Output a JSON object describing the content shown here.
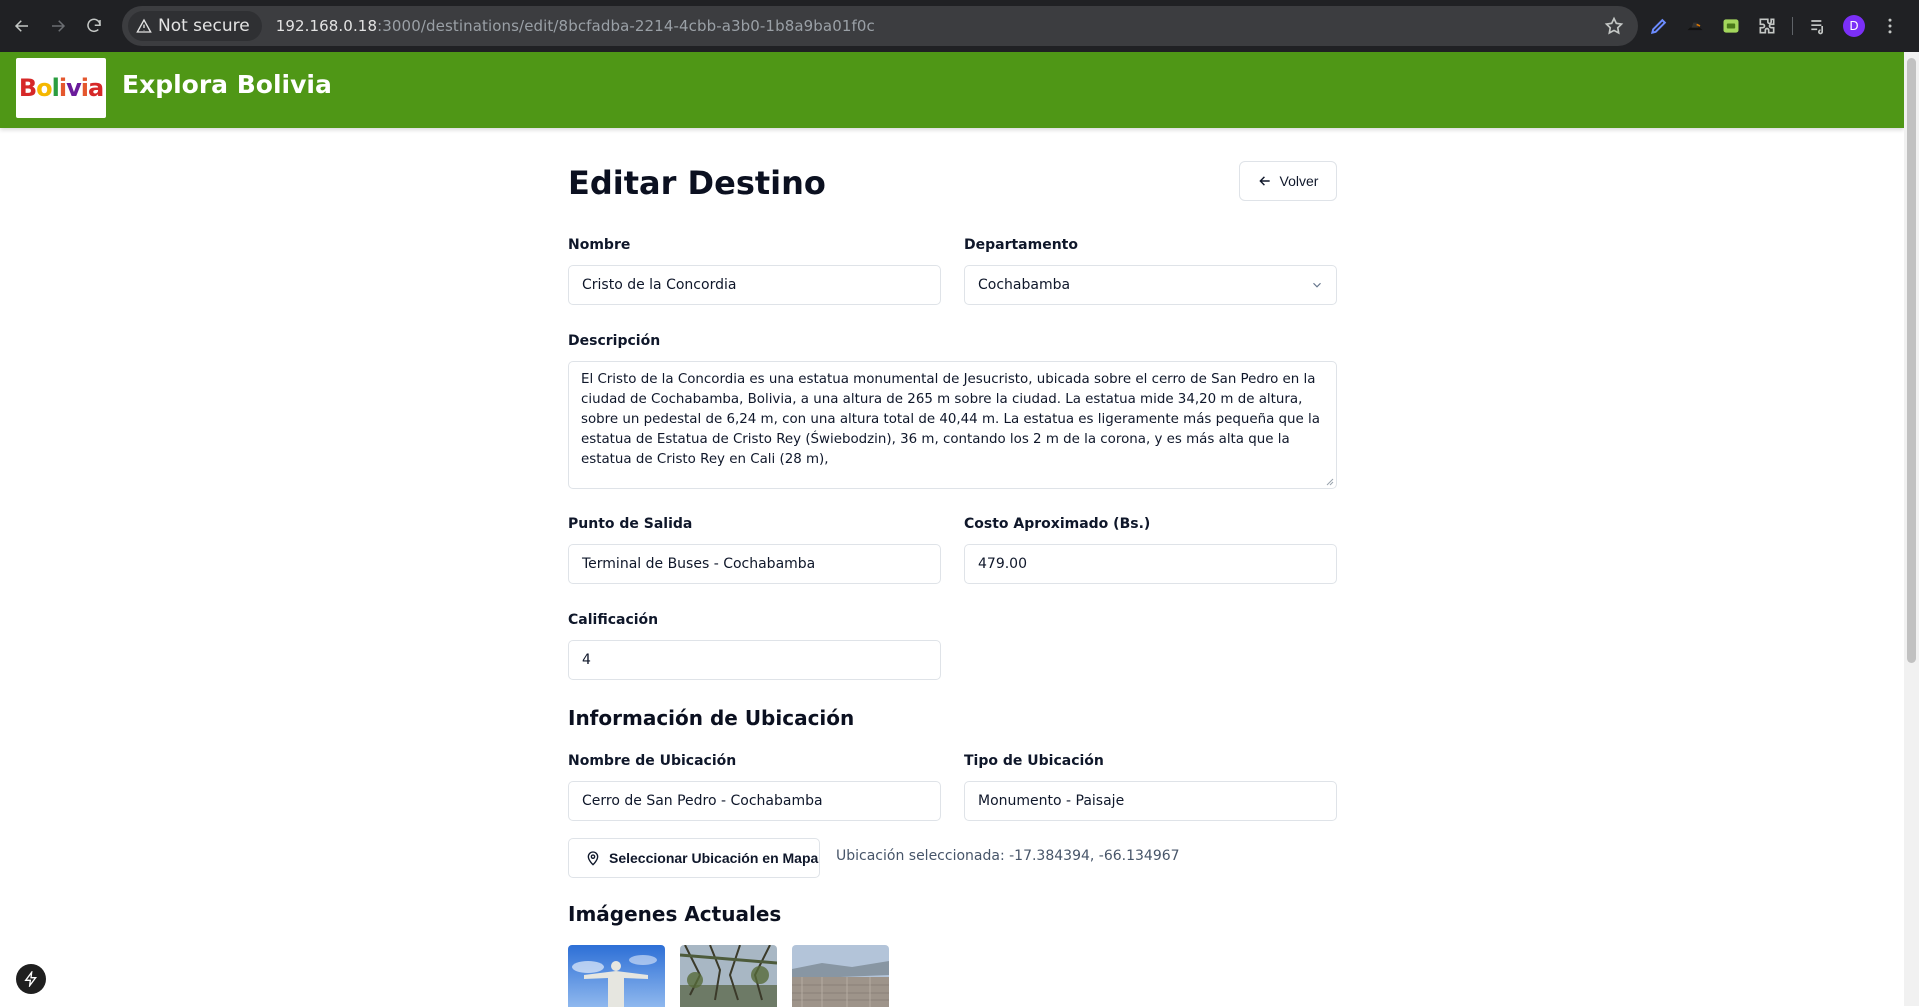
{
  "browser": {
    "security_label": "Not secure",
    "url_host": "192.168.0.18",
    "url_rest": ":3000/destinations/edit/8bcfadba-2214-4cbb-a3b0-1b8a9ba01f0c",
    "profile_initial": "D"
  },
  "header": {
    "logo_text": "Bolivia",
    "brand": "Explora Bolivia"
  },
  "page": {
    "title": "Editar Destino",
    "back_label": "Volver"
  },
  "form": {
    "nombre": {
      "label": "Nombre",
      "value": "Cristo de la Concordia"
    },
    "departamento": {
      "label": "Departamento",
      "value": "Cochabamba"
    },
    "descripcion": {
      "label": "Descripción",
      "value": "El Cristo de la Concordia es una estatua monumental de Jesucristo, ubicada sobre el cerro de San Pedro en la ciudad de Cochabamba, Bolivia, a una altura de 265 m sobre la ciudad. La estatua mide 34,20 m de altura, sobre un pedestal de 6,24 m, con una altura total de 40,44 m. La estatua es ligeramente más pequeña que la estatua de Estatua de Cristo Rey (Świebodzin), 36 m, contando los 2 m de la corona, y es más alta que la estatua de Cristo Rey en Cali (28 m),"
    },
    "punto_salida": {
      "label": "Punto de Salida",
      "value": "Terminal de Buses - Cochabamba"
    },
    "costo": {
      "label": "Costo Aproximado (Bs.)",
      "value": "479.00"
    },
    "calificacion": {
      "label": "Calificación",
      "value": "4"
    }
  },
  "ubicacion": {
    "section_title": "Información de Ubicación",
    "nombre": {
      "label": "Nombre de Ubicación",
      "value": "Cerro de San Pedro - Cochabamba"
    },
    "tipo": {
      "label": "Tipo de Ubicación",
      "value": "Monumento - Paisaje"
    },
    "map_button": "Seleccionar Ubicación en Mapa",
    "selected_text": "Ubicación seleccionada: -17.384394, -66.134967"
  },
  "imagenes": {
    "section_title": "Imágenes Actuales"
  },
  "colors": {
    "header_green": "#4f9716",
    "chrome_bg": "#202124"
  }
}
